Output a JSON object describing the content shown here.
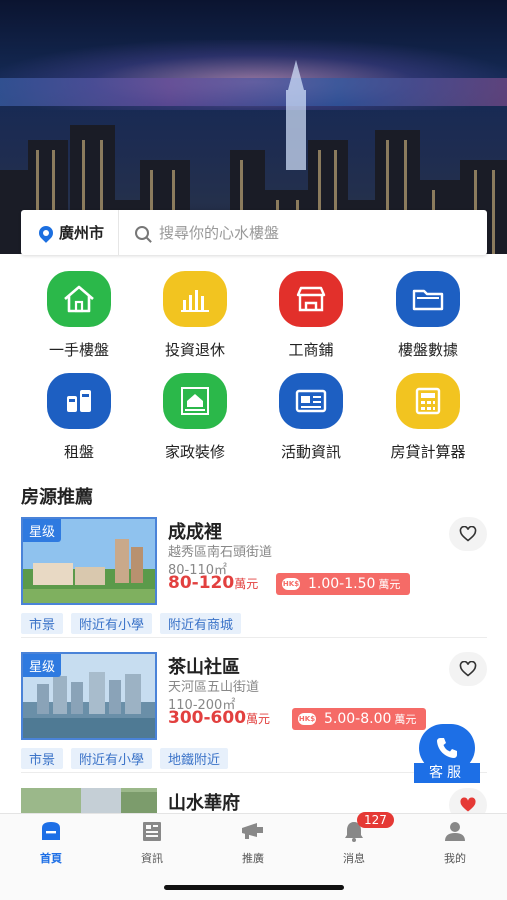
{
  "search": {
    "city": "廣州市",
    "placeholder": "搜尋你的心水樓盤"
  },
  "categories": [
    {
      "label": "一手樓盤",
      "icon": "house-icon",
      "color": "#2bb84a"
    },
    {
      "label": "投資退休",
      "icon": "bar-chart-icon",
      "color": "#f2c420"
    },
    {
      "label": "工商鋪",
      "icon": "storefront-icon",
      "color": "#e2302b"
    },
    {
      "label": "樓盤數據",
      "icon": "folder-icon",
      "color": "#1d5fc2"
    },
    {
      "label": "租盤",
      "icon": "rental-icon",
      "color": "#1d5fc2"
    },
    {
      "label": "家政裝修",
      "icon": "housekeeping-icon",
      "color": "#2bb84a"
    },
    {
      "label": "活動資訊",
      "icon": "news-icon",
      "color": "#1d5fc2"
    },
    {
      "label": "房貸計算器",
      "icon": "calculator-icon",
      "color": "#f2c420"
    }
  ],
  "section_title": "房源推薦",
  "listings": [
    {
      "badge": "星级",
      "name": "成成裡",
      "address": "越秀區南石頭街道",
      "area": "80-110㎡",
      "price": "80-120",
      "price_unit": "萬元",
      "hk_label": "HK$",
      "hk_price": "1.00-1.50",
      "hk_unit": "萬元",
      "tags": [
        "市景",
        "附近有小學",
        "附近有商城"
      ],
      "favorited": false
    },
    {
      "badge": "星级",
      "name": "茶山社區",
      "address": "天河區五山街道",
      "area": "110-200㎡",
      "price": "300-600",
      "price_unit": "萬元",
      "hk_label": "HK$",
      "hk_price": "5.00-8.00",
      "hk_unit": "萬元",
      "tags": [
        "市景",
        "附近有小學",
        "地鐵附近"
      ],
      "favorited": false
    },
    {
      "name": "山水華府",
      "favorited": true
    }
  ],
  "customer_service": "客服",
  "tabs": [
    {
      "label": "首頁",
      "icon": "home-icon",
      "active": true
    },
    {
      "label": "資訊",
      "icon": "news-tab-icon",
      "active": false
    },
    {
      "label": "推廣",
      "icon": "promote-icon",
      "active": false
    },
    {
      "label": "消息",
      "icon": "bell-icon",
      "active": false,
      "badge": "127"
    },
    {
      "label": "我的",
      "icon": "profile-icon",
      "active": false
    }
  ],
  "colors": {
    "accent": "#1d6fe6",
    "price": "#e2403f",
    "hk_price_bg": "#f56b67",
    "tag_bg": "#e7f0fb",
    "tag_text": "#3b73c8"
  }
}
